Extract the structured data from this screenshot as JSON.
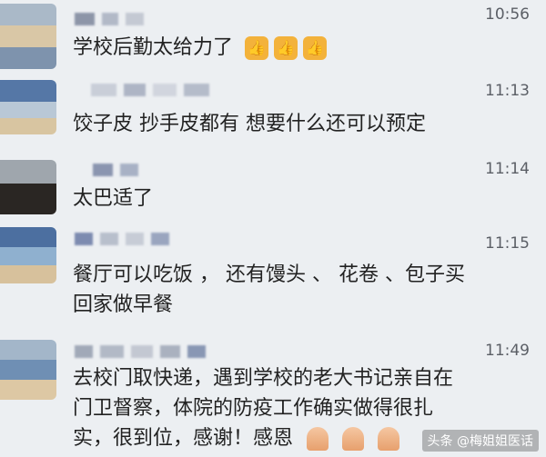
{
  "messages": [
    {
      "time": "10:56",
      "text": "学校后勤太给力了",
      "emoji": [
        "thumbs-up",
        "thumbs-up",
        "thumbs-up"
      ]
    },
    {
      "time": "11:13",
      "text": "饺子皮  抄手皮都有  想要什么还可以预定"
    },
    {
      "time": "11:14",
      "text": "太巴适了"
    },
    {
      "time": "11:15",
      "lines": [
        "餐厅可以吃饭 ， 还有馒头 、 花卷 、包子买",
        "回家做早餐"
      ]
    },
    {
      "time": "11:49",
      "lines": [
        "去校门取快递，遇到学校的老大书记亲自在",
        "门卫督察，体院的防疫工作确实做得很扎",
        "实，很到位，感谢！感恩"
      ],
      "emoji": [
        "folded-hands",
        "folded-hands",
        "folded-hands"
      ]
    }
  ],
  "watermark": "头条 @梅姐姐医话",
  "colors": {
    "background": "#eceff2",
    "text": "#222222",
    "time": "#5b5f66"
  }
}
